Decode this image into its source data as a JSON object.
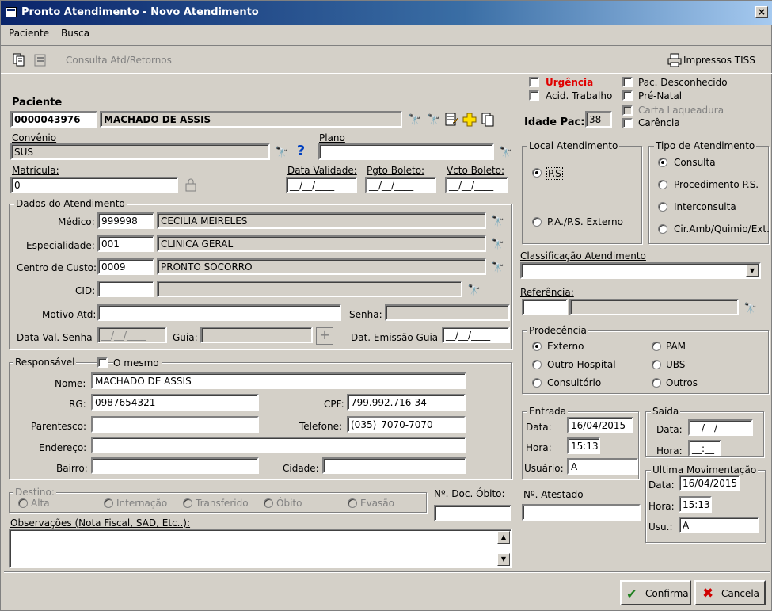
{
  "window": {
    "title": "Pronto Atendimento - Novo Atendimento",
    "close": "×"
  },
  "menu": {
    "paciente": "Paciente",
    "busca": "Busca"
  },
  "toolbar": {
    "consulta": "Consulta Atd/Retornos",
    "impressos": "Impressos TISS"
  },
  "checks": {
    "urgencia": "Urgência",
    "acid_trabalho": "Acid. Trabalho",
    "pac_desconhecido": "Pac. Desconhecido",
    "pre_natal": "Pré-Natal",
    "carta_laqueadura": "Carta Laqueadura",
    "carencia": "Carência"
  },
  "paciente": {
    "label": "Paciente",
    "code": "0000043976",
    "name": "MACHADO DE ASSIS",
    "idade_label": "Idade Pac:",
    "idade": "38"
  },
  "convenio": {
    "label": "Convênio",
    "value": "SUS",
    "plano_label": "Plano",
    "plano": ""
  },
  "matricula": {
    "label": "Matrícula:",
    "value": "0",
    "validade_label": "Data Validade:",
    "validade": "__/__/____",
    "pgto_label": "Pgto Boleto:",
    "pgto": "__/__/____",
    "vcto_label": "Vcto Boleto:",
    "vcto": "__/__/____"
  },
  "dados": {
    "title": "Dados do Atendimento",
    "medico_label": "Médico:",
    "medico_code": "999998",
    "medico_name": "CECILIA MEIRELES",
    "esp_label": "Especialidade:",
    "esp_code": "001",
    "esp_name": "CLINICA GERAL",
    "cc_label": "Centro de Custo:",
    "cc_code": "0009",
    "cc_name": "PRONTO SOCORRO",
    "cid_label": "CID:",
    "cid_code": "",
    "cid_name": "",
    "motivo_label": "Motivo Atd:",
    "motivo": "",
    "senha_label": "Senha:",
    "senha": "",
    "valsenha_label": "Data Val. Senha",
    "valsenha": "__/__/____",
    "guia_label": "Guia:",
    "guia": "",
    "emissao_label": "Dat. Emissão Guia",
    "emissao": "__/__/____"
  },
  "responsavel": {
    "title": "Responsável",
    "omesmo": "O mesmo",
    "nome_label": "Nome:",
    "nome": "MACHADO DE ASSIS",
    "rg_label": "RG:",
    "rg": "0987654321",
    "cpf_label": "CPF:",
    "cpf": "799.992.716-34",
    "parentesco_label": "Parentesco:",
    "parentesco": "",
    "telefone_label": "Telefone:",
    "telefone": "(035)_7070-7070",
    "endereco_label": "Endereço:",
    "endereco": "",
    "bairro_label": "Bairro:",
    "bairro": "",
    "cidade_label": "Cidade:",
    "cidade": ""
  },
  "destino": {
    "title": "Destino:",
    "alta": "Alta",
    "internacao": "Internação",
    "transferido": "Transferido",
    "obito": "Óbito",
    "evasao": "Evasão",
    "doc_obito_label": "Nº. Doc. Óbito:",
    "doc_obito": ""
  },
  "obs": {
    "label": "Observações (Nota Fiscal, SAD, Etc..):",
    "value": ""
  },
  "local": {
    "title": "Local Atendimento",
    "ps": "P.S",
    "pa": "P.A./P.S. Externo"
  },
  "tipo": {
    "title": "Tipo de Atendimento",
    "consulta": "Consulta",
    "procedimento": "Procedimento P.S.",
    "interconsulta": "Interconsulta",
    "cir": "Cir.Amb/Quimio/Ext."
  },
  "classificacao": {
    "label": "Classificação Atendimento",
    "value": ""
  },
  "referencia": {
    "label": "Referência:",
    "code": "",
    "name": ""
  },
  "procedencia": {
    "title": "Prodecência",
    "externo": "Externo",
    "outro_hospital": "Outro Hospital",
    "consultorio": "Consultório",
    "pam": "PAM",
    "ubs": "UBS",
    "outros": "Outros"
  },
  "entrada": {
    "title": "Entrada",
    "data_label": "Data:",
    "data": "16/04/2015",
    "hora_label": "Hora:",
    "hora": "15:13",
    "usuario_label": "Usuário:",
    "usuario": "A"
  },
  "saida": {
    "title": "Saída",
    "data_label": "Data:",
    "data": "__/__/____",
    "hora_label": "Hora:",
    "hora": "__:__"
  },
  "atestado": {
    "label": "Nº. Atestado",
    "value": ""
  },
  "ultima": {
    "title": "Ultima Movimentação",
    "data_label": "Data:",
    "data": "16/04/2015",
    "hora_label": "Hora:",
    "hora": "15:13",
    "usu_label": "Usu.:",
    "usu": "A"
  },
  "buttons": {
    "confirma": "Confirma",
    "cancela": "Cancela"
  }
}
